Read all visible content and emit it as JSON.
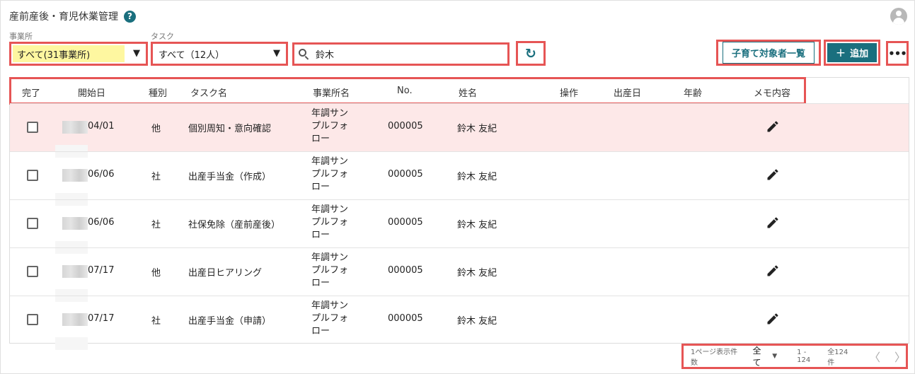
{
  "header": {
    "title": "産前産後・育児休業管理",
    "help_symbol": "?"
  },
  "filters": {
    "office_label": "事業所",
    "office_value": "すべて(31事業所)",
    "task_label": "タスク",
    "task_value": "すべて（12人）",
    "dropdown_arrow": "▼",
    "search_value": "鈴木"
  },
  "toolbar": {
    "refresh_symbol": "↻",
    "kids_list_label": "子育て対象者一覧",
    "add_label": "追加",
    "add_symbol": "+",
    "more_symbol": "•••"
  },
  "table": {
    "columns": [
      "完了",
      "開始日",
      "種別",
      "タスク名",
      "事業所名",
      "No.",
      "姓名",
      "操作",
      "出産日",
      "年齢",
      "メモ内容"
    ],
    "rows": [
      {
        "date": "04/01",
        "type": "他",
        "task": "個別周知・意向確認",
        "office": "年調サンプルフォロー",
        "no": "000005",
        "name": "鈴木 友紀"
      },
      {
        "date": "06/06",
        "type": "社",
        "task": "出産手当金（作成）",
        "office": "年調サンプルフォロー",
        "no": "000005",
        "name": "鈴木 友紀"
      },
      {
        "date": "06/06",
        "type": "社",
        "task": "社保免除（産前産後）",
        "office": "年調サンプルフォロー",
        "no": "000005",
        "name": "鈴木 友紀"
      },
      {
        "date": "07/17",
        "type": "他",
        "task": "出産日ヒアリング",
        "office": "年調サンプルフォロー",
        "no": "000005",
        "name": "鈴木 友紀"
      },
      {
        "date": "07/17",
        "type": "社",
        "task": "出産手当金（申請）",
        "office": "年調サンプルフォロー",
        "no": "000005",
        "name": "鈴木 友紀"
      }
    ]
  },
  "pagination": {
    "per_page_label": "1ページ表示件数",
    "per_page_value": "全て",
    "range": "1 - 124",
    "total": "全124件",
    "prev_symbol": "〈",
    "next_symbol": "〉"
  },
  "colors": {
    "accent": "#1a6f7e",
    "highlight_border": "#e65555",
    "selected_filter_bg": "#fef7a0",
    "first_row_bg": "#fde8e8"
  }
}
